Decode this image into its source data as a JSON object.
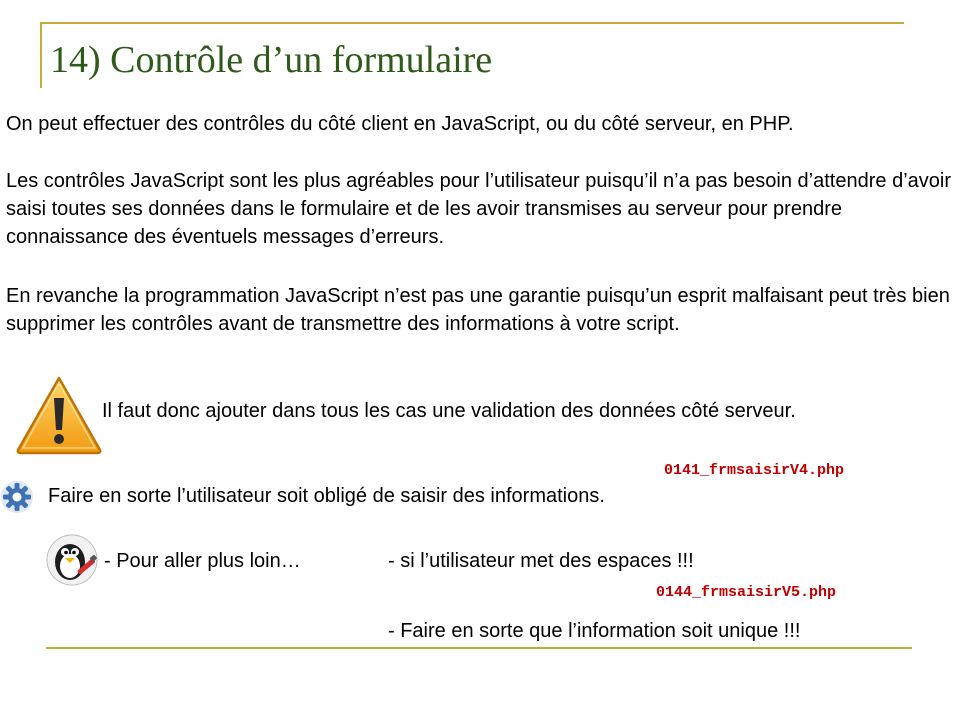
{
  "slide": {
    "title": "14) Contrôle d’un formulaire",
    "paragraphs": {
      "p1": "On peut effectuer des contrôles du côté client en JavaScript, ou du côté serveur, en PHP.",
      "p2": "Les contrôles JavaScript sont les plus agréables pour l’utilisateur puisqu’il n’a pas besoin d’attendre d’avoir saisi toutes ses données dans le formulaire et de les avoir transmises au serveur pour prendre connaissance des éventuels messages d’erreurs.",
      "p3": "En revanche la programmation JavaScript n’est pas une garantie puisqu’un esprit malfaisant peut très bien supprimer les contrôles avant de transmettre des informations à votre script."
    },
    "warning": {
      "icon": "warning-triangle-icon",
      "text": "Il faut donc ajouter dans tous les cas une validation des données côté serveur."
    },
    "file1": "0141_frmsaisirV4.php",
    "task": {
      "icon": "gear-icon",
      "text": "Faire en sorte l’utilisateur soit obligé de saisir des informations."
    },
    "further": {
      "icon": "penguin-icon",
      "label": "- Pour aller plus loin…",
      "item1": "- si l’utilisateur met des espaces !!!",
      "file2": "0144_frmsaisirV5.php",
      "item2": "- Faire en sorte que l’information soit unique !!!"
    },
    "colors": {
      "title": "#2e5a1a",
      "rule": "#c9a93a",
      "filename": "#c00000"
    }
  }
}
